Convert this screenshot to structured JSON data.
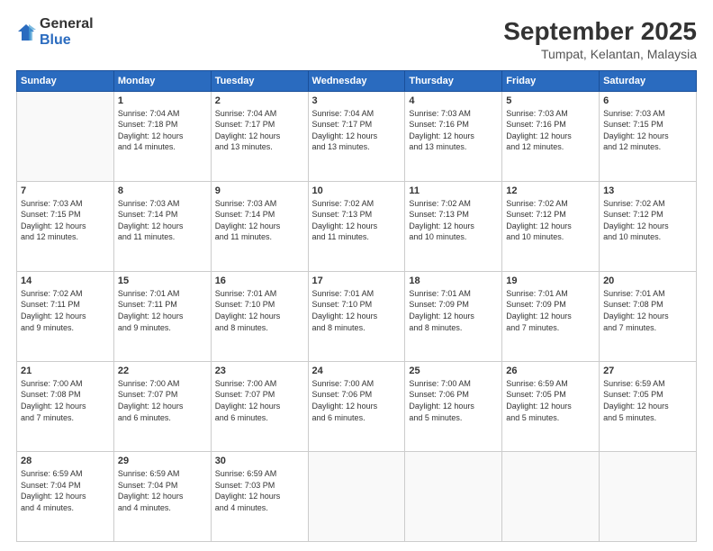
{
  "logo": {
    "general": "General",
    "blue": "Blue"
  },
  "title": "September 2025",
  "subtitle": "Tumpat, Kelantan, Malaysia",
  "days_of_week": [
    "Sunday",
    "Monday",
    "Tuesday",
    "Wednesday",
    "Thursday",
    "Friday",
    "Saturday"
  ],
  "weeks": [
    [
      {
        "day": "",
        "info": ""
      },
      {
        "day": "1",
        "info": "Sunrise: 7:04 AM\nSunset: 7:18 PM\nDaylight: 12 hours\nand 14 minutes."
      },
      {
        "day": "2",
        "info": "Sunrise: 7:04 AM\nSunset: 7:17 PM\nDaylight: 12 hours\nand 13 minutes."
      },
      {
        "day": "3",
        "info": "Sunrise: 7:04 AM\nSunset: 7:17 PM\nDaylight: 12 hours\nand 13 minutes."
      },
      {
        "day": "4",
        "info": "Sunrise: 7:03 AM\nSunset: 7:16 PM\nDaylight: 12 hours\nand 13 minutes."
      },
      {
        "day": "5",
        "info": "Sunrise: 7:03 AM\nSunset: 7:16 PM\nDaylight: 12 hours\nand 12 minutes."
      },
      {
        "day": "6",
        "info": "Sunrise: 7:03 AM\nSunset: 7:15 PM\nDaylight: 12 hours\nand 12 minutes."
      }
    ],
    [
      {
        "day": "7",
        "info": "Sunrise: 7:03 AM\nSunset: 7:15 PM\nDaylight: 12 hours\nand 12 minutes."
      },
      {
        "day": "8",
        "info": "Sunrise: 7:03 AM\nSunset: 7:14 PM\nDaylight: 12 hours\nand 11 minutes."
      },
      {
        "day": "9",
        "info": "Sunrise: 7:03 AM\nSunset: 7:14 PM\nDaylight: 12 hours\nand 11 minutes."
      },
      {
        "day": "10",
        "info": "Sunrise: 7:02 AM\nSunset: 7:13 PM\nDaylight: 12 hours\nand 11 minutes."
      },
      {
        "day": "11",
        "info": "Sunrise: 7:02 AM\nSunset: 7:13 PM\nDaylight: 12 hours\nand 10 minutes."
      },
      {
        "day": "12",
        "info": "Sunrise: 7:02 AM\nSunset: 7:12 PM\nDaylight: 12 hours\nand 10 minutes."
      },
      {
        "day": "13",
        "info": "Sunrise: 7:02 AM\nSunset: 7:12 PM\nDaylight: 12 hours\nand 10 minutes."
      }
    ],
    [
      {
        "day": "14",
        "info": "Sunrise: 7:02 AM\nSunset: 7:11 PM\nDaylight: 12 hours\nand 9 minutes."
      },
      {
        "day": "15",
        "info": "Sunrise: 7:01 AM\nSunset: 7:11 PM\nDaylight: 12 hours\nand 9 minutes."
      },
      {
        "day": "16",
        "info": "Sunrise: 7:01 AM\nSunset: 7:10 PM\nDaylight: 12 hours\nand 8 minutes."
      },
      {
        "day": "17",
        "info": "Sunrise: 7:01 AM\nSunset: 7:10 PM\nDaylight: 12 hours\nand 8 minutes."
      },
      {
        "day": "18",
        "info": "Sunrise: 7:01 AM\nSunset: 7:09 PM\nDaylight: 12 hours\nand 8 minutes."
      },
      {
        "day": "19",
        "info": "Sunrise: 7:01 AM\nSunset: 7:09 PM\nDaylight: 12 hours\nand 7 minutes."
      },
      {
        "day": "20",
        "info": "Sunrise: 7:01 AM\nSunset: 7:08 PM\nDaylight: 12 hours\nand 7 minutes."
      }
    ],
    [
      {
        "day": "21",
        "info": "Sunrise: 7:00 AM\nSunset: 7:08 PM\nDaylight: 12 hours\nand 7 minutes."
      },
      {
        "day": "22",
        "info": "Sunrise: 7:00 AM\nSunset: 7:07 PM\nDaylight: 12 hours\nand 6 minutes."
      },
      {
        "day": "23",
        "info": "Sunrise: 7:00 AM\nSunset: 7:07 PM\nDaylight: 12 hours\nand 6 minutes."
      },
      {
        "day": "24",
        "info": "Sunrise: 7:00 AM\nSunset: 7:06 PM\nDaylight: 12 hours\nand 6 minutes."
      },
      {
        "day": "25",
        "info": "Sunrise: 7:00 AM\nSunset: 7:06 PM\nDaylight: 12 hours\nand 5 minutes."
      },
      {
        "day": "26",
        "info": "Sunrise: 6:59 AM\nSunset: 7:05 PM\nDaylight: 12 hours\nand 5 minutes."
      },
      {
        "day": "27",
        "info": "Sunrise: 6:59 AM\nSunset: 7:05 PM\nDaylight: 12 hours\nand 5 minutes."
      }
    ],
    [
      {
        "day": "28",
        "info": "Sunrise: 6:59 AM\nSunset: 7:04 PM\nDaylight: 12 hours\nand 4 minutes."
      },
      {
        "day": "29",
        "info": "Sunrise: 6:59 AM\nSunset: 7:04 PM\nDaylight: 12 hours\nand 4 minutes."
      },
      {
        "day": "30",
        "info": "Sunrise: 6:59 AM\nSunset: 7:03 PM\nDaylight: 12 hours\nand 4 minutes."
      },
      {
        "day": "",
        "info": ""
      },
      {
        "day": "",
        "info": ""
      },
      {
        "day": "",
        "info": ""
      },
      {
        "day": "",
        "info": ""
      }
    ]
  ]
}
